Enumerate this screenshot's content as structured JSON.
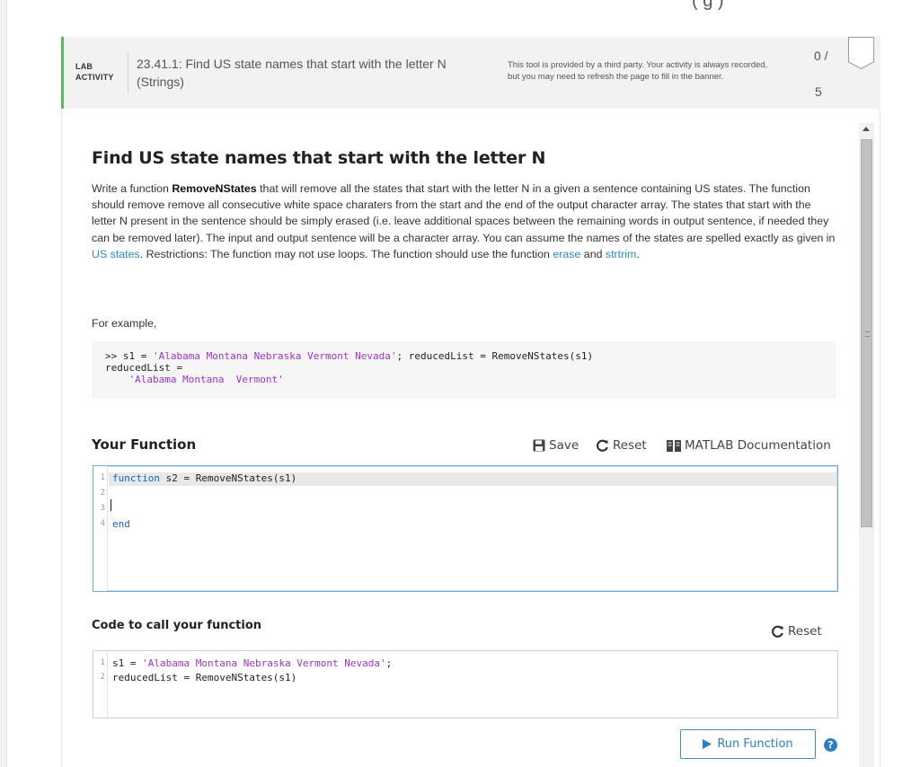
{
  "header": {
    "lab_tag_line1": "LAB",
    "lab_tag_line2": "ACTIVITY",
    "title": "23.41.1: Find US state names that start with the letter N (Strings)",
    "notice": "This tool is provided by a third party. Your activity is always recorded, but you may need to refresh the page to fill in the banner.",
    "score_earned": "0 /",
    "score_total": "5",
    "top_partial_text": "(   g   )"
  },
  "problem": {
    "title": "Find US state names that start with the letter N",
    "desc_1": "Write a function ",
    "function_name": "RemoveNStates",
    "desc_2": " that will remove all the states that start with the letter N in a given a sentence containing US states.  The function should remove remove all consecutive white space charaters from the start and the end of the output character array.  The states that start with the letter N present in the sentence should be simply erased (i.e. leave additional spaces between the remaining words in output sentence, if needed they can be removed later). The input and output sentence will be a character array. You can assume the names of the states are spelled exactly as given in ",
    "link_us_states": "US states",
    "desc_3": ".   Restrictions:  The function may not use loops. The function should use the function ",
    "link_erase": "erase",
    "desc_4": " and ",
    "link_strtrim": "strtrim",
    "desc_5": ".",
    "for_example": "For example,",
    "example_line1_prefix": ">> s1 = ",
    "example_line1_str": "'Alabama Montana Nebraska Vermont Nevada'",
    "example_line1_suffix": "; reducedList = RemoveNStates(s1)",
    "example_line2": "reducedList =",
    "example_line3_indent": "    ",
    "example_line3_str": "'Alabama Montana  Vermont'"
  },
  "your_function": {
    "title": "Your Function",
    "save_label": "Save",
    "reset_label": "Reset",
    "doc_label": "MATLAB Documentation",
    "line_numbers": [
      "1",
      "2",
      "3",
      "4"
    ],
    "line1_kw": "function",
    "line1_rest": " s2 = RemoveNStates(s1)",
    "line4_kw": "end"
  },
  "call_function": {
    "title": "Code to call your function",
    "reset_label": "Reset",
    "line_numbers": [
      "1",
      "2"
    ],
    "line1_prefix": "s1 = ",
    "line1_str": "'Alabama Montana Nebraska Vermont Nevada'",
    "line1_suffix": ";",
    "line2": "reducedList = RemoveNStates(s1)"
  },
  "actions": {
    "run_label": "Run Function",
    "help_glyph": "?"
  },
  "colors": {
    "accent_green": "#5cb85c",
    "link_blue": "#2a8ec4",
    "string_purple": "#a033c8",
    "keyword_blue": "#1565c0"
  }
}
